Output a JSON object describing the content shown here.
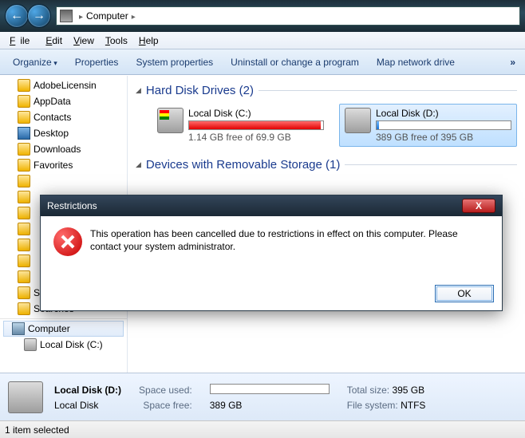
{
  "chrome": {
    "back_glyph": "←",
    "fwd_glyph": "→",
    "location": "Computer",
    "sep": "▸"
  },
  "menubar": {
    "file": "File",
    "edit": "Edit",
    "view": "View",
    "tools": "Tools",
    "help": "Help"
  },
  "toolbar": {
    "organize": "Organize",
    "properties": "Properties",
    "sysprops": "System properties",
    "uninstall": "Uninstall or change a program",
    "mapdrive": "Map network drive",
    "more": "»"
  },
  "sidebar": {
    "items": [
      "AdobeLicensin",
      "AppData",
      "Contacts",
      "Desktop",
      "Downloads",
      "Favorites",
      "",
      "",
      "",
      "",
      "",
      "",
      "",
      "Saved Games",
      "Searches"
    ],
    "computer": "Computer",
    "drive": "Local Disk (C:)"
  },
  "groups": {
    "hdd": {
      "title": "Hard Disk Drives (2)"
    },
    "rem": {
      "title": "Devices with Removable Storage (1)"
    }
  },
  "drives": {
    "c": {
      "label": "Local Disk (C:)",
      "free": "1.14 GB free of 69.9 GB"
    },
    "d": {
      "label": "Local Disk (D:)",
      "free": "389 GB free of 395 GB"
    }
  },
  "details": {
    "name": "Local Disk (D:)",
    "type": "Local Disk",
    "used_lbl": "Space used:",
    "free_lbl": "Space free:",
    "free_val": "389 GB",
    "total_lbl": "Total size:",
    "total_val": "395 GB",
    "fs_lbl": "File system:",
    "fs_val": "NTFS"
  },
  "status": {
    "text": "1 item selected"
  },
  "dialog": {
    "title": "Restrictions",
    "message": "This operation has been cancelled due to restrictions in effect on this computer. Please contact your system administrator.",
    "ok": "OK",
    "close_glyph": "X"
  }
}
